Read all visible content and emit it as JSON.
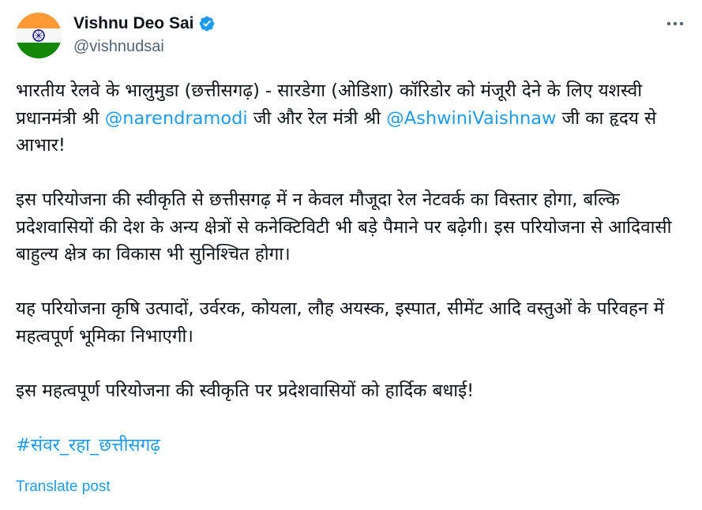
{
  "author": {
    "display_name": "Vishnu Deo Sai",
    "handle": "@vishnudsai",
    "verified_icon": "verified-badge-icon",
    "avatar_icon": "india-flag-avatar"
  },
  "menu": {
    "more_icon": "more-horizontal-icon"
  },
  "post": {
    "p1": {
      "t1": "भारतीय रेलवे के भालुमुडा (छत्तीसगढ़) - सारडेगा (ओडिशा) कॉरिडोर को मंजूरी देने के लिए यशस्वी प्रधानमंत्री श्री ",
      "mention1": "@narendramodi",
      "t2": " जी और रेल मंत्री श्री ",
      "mention2": "@AshwiniVaishnaw",
      "t3": " जी का हृदय से आभार!"
    },
    "p2": "इस परियोजना की स्वीकृति से छत्तीसगढ़ में न केवल मौजूदा रेल नेटवर्क का विस्तार होगा, बल्कि प्रदेशवासियों की देश के अन्य क्षेत्रों से कनेक्टिविटी भी बड़े पैमाने पर बढ़ेगी। इस परियोजना से आदिवासी बाहुल्य क्षेत्र का विकास भी सुनिश्चित होगा।",
    "p3": "यह परियोजना कृषि उत्पादों, उर्वरक, कोयला, लौह अयस्क, इस्पात, सीमेंट आदि वस्तुओं के परिवहन में महत्वपूर्ण भूमिका निभाएगी।",
    "p4": "इस महत्वपूर्ण परियोजना की स्वीकृति पर प्रदेशवासियों को हार्दिक बधाई!",
    "hashtag": "#संवर_रहा_छत्तीसगढ़"
  },
  "translate_label": "Translate post",
  "colors": {
    "link": "#1d9bf0",
    "text": "#0f1419",
    "secondary": "#536471",
    "saffron": "#ff9933",
    "green": "#138808",
    "chakra": "#000080"
  }
}
